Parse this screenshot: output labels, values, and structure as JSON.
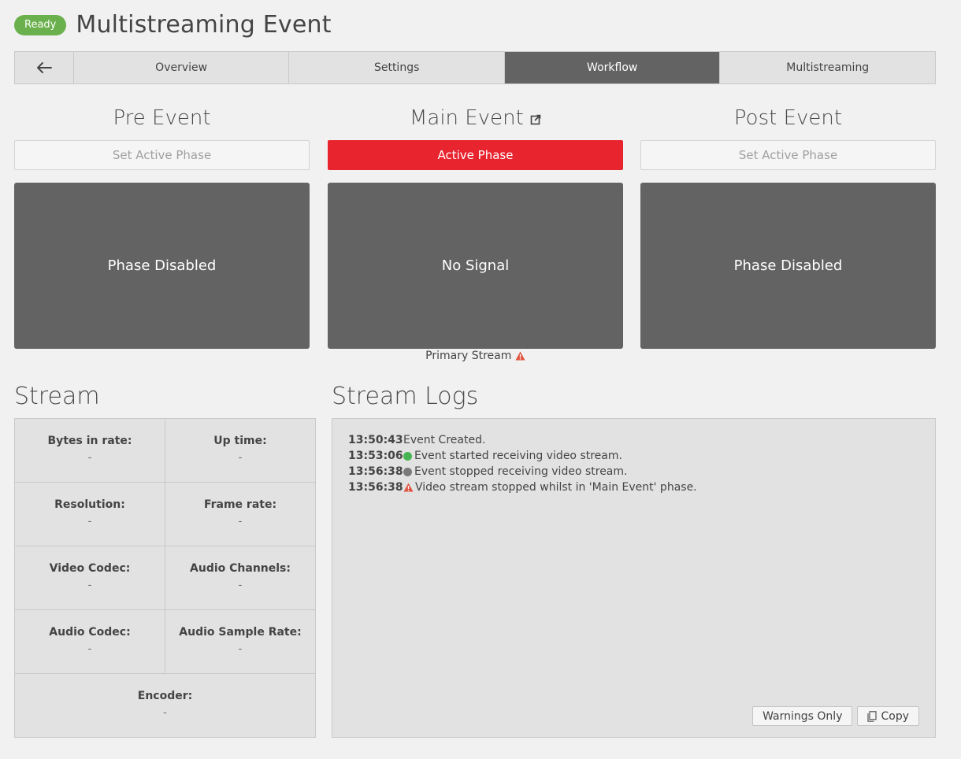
{
  "header": {
    "badge": "Ready",
    "title": "Multistreaming Event"
  },
  "tabs": [
    {
      "label": "Overview"
    },
    {
      "label": "Settings"
    },
    {
      "label": "Workflow",
      "active": true
    },
    {
      "label": "Multistreaming"
    }
  ],
  "phases": [
    {
      "title": "Pre Event",
      "button": "Set Active Phase",
      "status": "Phase Disabled"
    },
    {
      "title": "Main Event",
      "button": "Active Phase",
      "status": "No Signal",
      "stream_label": "Primary Stream"
    },
    {
      "title": "Post Event",
      "button": "Set Active Phase",
      "status": "Phase Disabled"
    }
  ],
  "stream": {
    "heading": "Stream",
    "fields": [
      {
        "label": "Bytes in rate:",
        "value": "-"
      },
      {
        "label": "Up time:",
        "value": "-"
      },
      {
        "label": "Resolution:",
        "value": "-"
      },
      {
        "label": "Frame rate:",
        "value": "-"
      },
      {
        "label": "Video Codec:",
        "value": "-"
      },
      {
        "label": "Audio Channels:",
        "value": "-"
      },
      {
        "label": "Audio Codec:",
        "value": "-"
      },
      {
        "label": "Audio Sample Rate:",
        "value": "-"
      },
      {
        "label": "Encoder:",
        "value": "-"
      }
    ]
  },
  "logs": {
    "heading": "Stream Logs",
    "entries": [
      {
        "time": "13:50:43",
        "icon": "none",
        "message": "Event Created."
      },
      {
        "time": "13:53:06",
        "icon": "green-dot-icon",
        "message": "Event started receiving video stream."
      },
      {
        "time": "13:56:38",
        "icon": "grey-dot-icon",
        "message": "Event stopped receiving video stream."
      },
      {
        "time": "13:56:38",
        "icon": "warning-icon",
        "message": "Video stream stopped whilst in 'Main Event' phase."
      }
    ],
    "warnings_button": "Warnings Only",
    "copy_button": "Copy"
  },
  "colors": {
    "ready": "#6ab04c",
    "active_phase": "#e8242f",
    "active_tab": "#636363",
    "green_dot": "#46b450",
    "grey_dot": "#7a7a7a",
    "warning": "#e0533f"
  }
}
